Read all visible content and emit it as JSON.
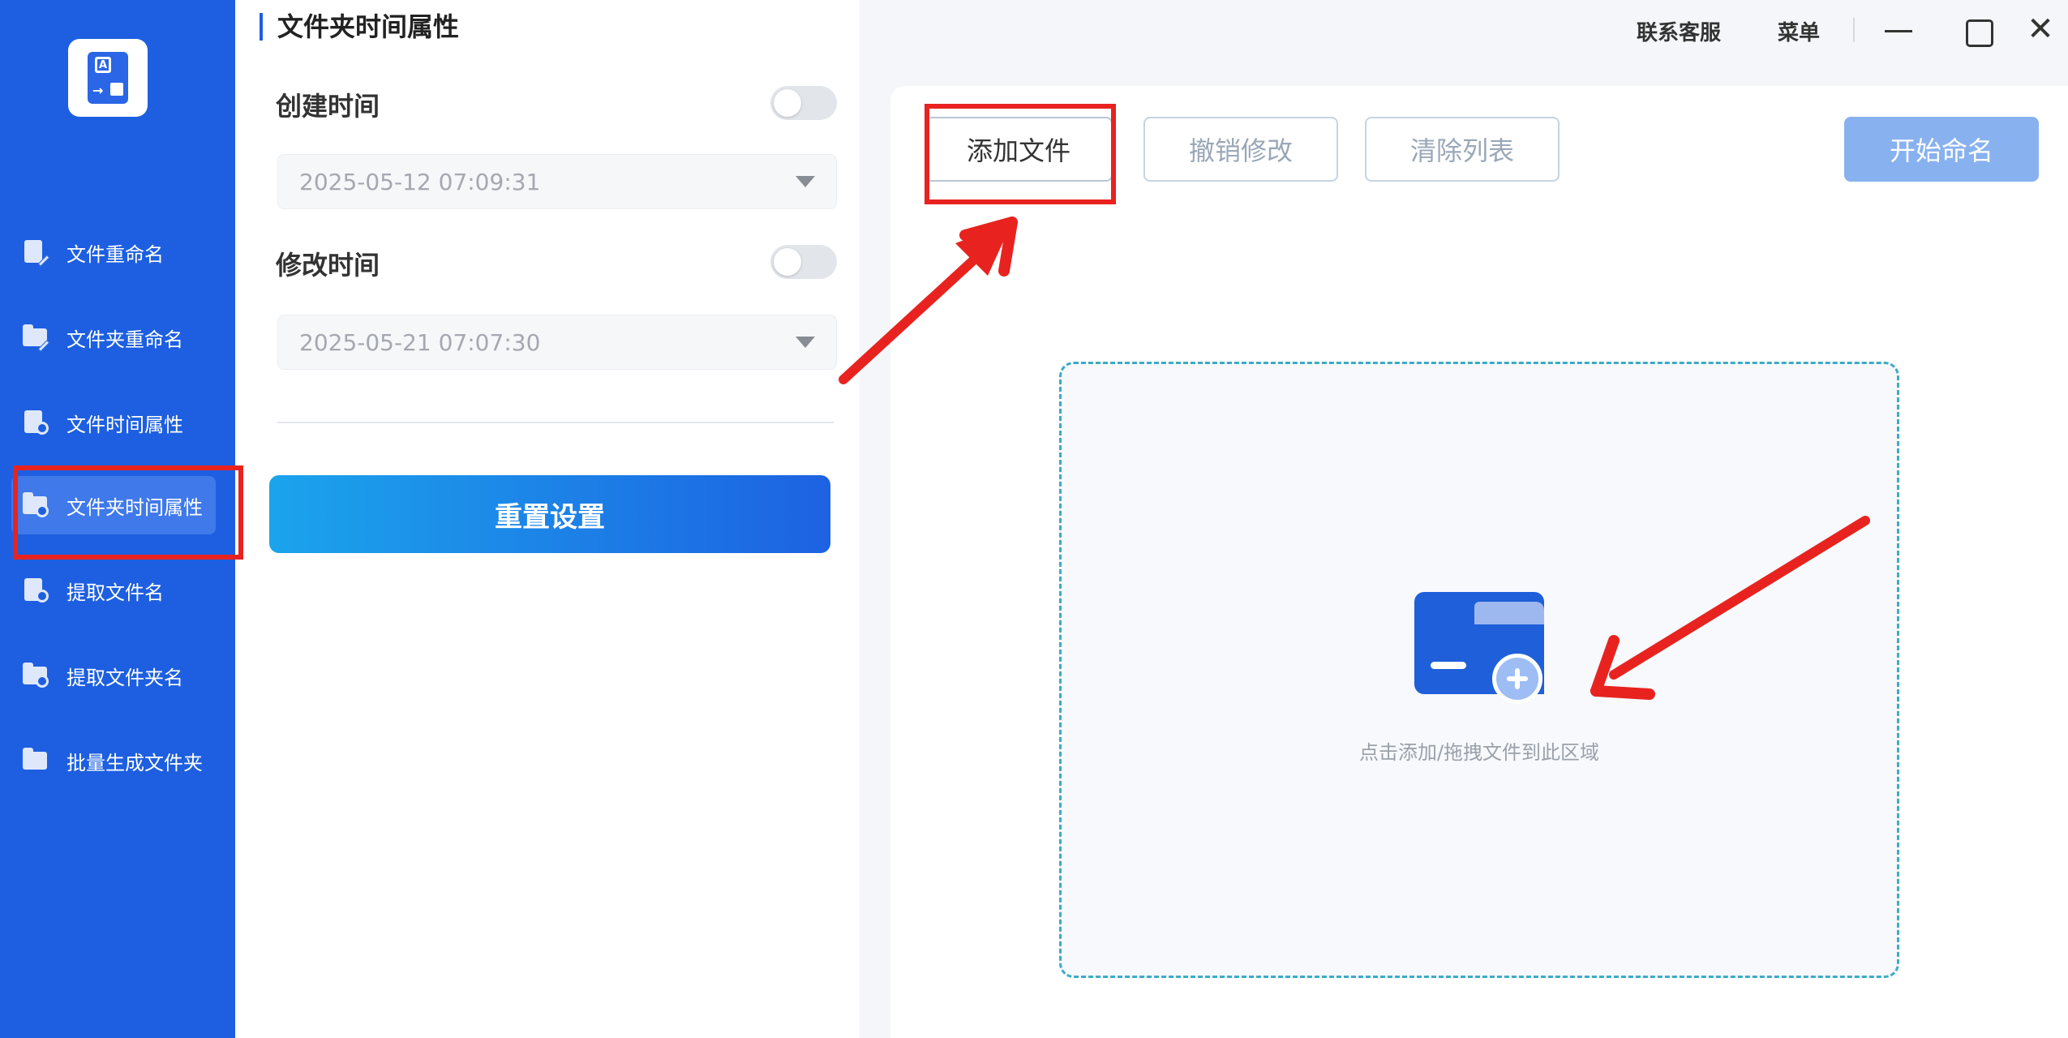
{
  "app": {
    "logo_icon": "file-rename-logo-icon"
  },
  "sidebar": {
    "items": [
      {
        "label": "文件重命名",
        "icon": "file-edit-icon",
        "active": false
      },
      {
        "label": "文件夹重命名",
        "icon": "folder-edit-icon",
        "active": false
      },
      {
        "label": "文件时间属性",
        "icon": "file-clock-icon",
        "active": false
      },
      {
        "label": "文件夹时间属性",
        "icon": "folder-clock-icon",
        "active": true
      },
      {
        "label": "提取文件名",
        "icon": "file-extract-icon",
        "active": false
      },
      {
        "label": "提取文件夹名",
        "icon": "folder-extract-icon",
        "active": false
      },
      {
        "label": "批量生成文件夹",
        "icon": "folders-icon",
        "active": false
      }
    ]
  },
  "panel": {
    "title": "文件夹时间属性",
    "created": {
      "label": "创建时间",
      "value": "2025-05-12 07:09:31",
      "enabled": false
    },
    "modified": {
      "label": "修改时间",
      "value": "2025-05-21 07:07:30",
      "enabled": false
    },
    "reset_label": "重置设置"
  },
  "header": {
    "contact_label": "联系客服",
    "menu_label": "菜单"
  },
  "toolbar": {
    "add_label": "添加文件",
    "undo_label": "撤销修改",
    "clear_label": "清除列表",
    "start_label": "开始命名"
  },
  "dropzone": {
    "hint": "点击添加/拖拽文件到此区域",
    "icon": "folder-add-icon"
  },
  "colors": {
    "sidebar": "#1d5fe0",
    "accent": "#1d62e2",
    "annotation": "#e8231f",
    "dropzone_border": "#3cabc6"
  }
}
